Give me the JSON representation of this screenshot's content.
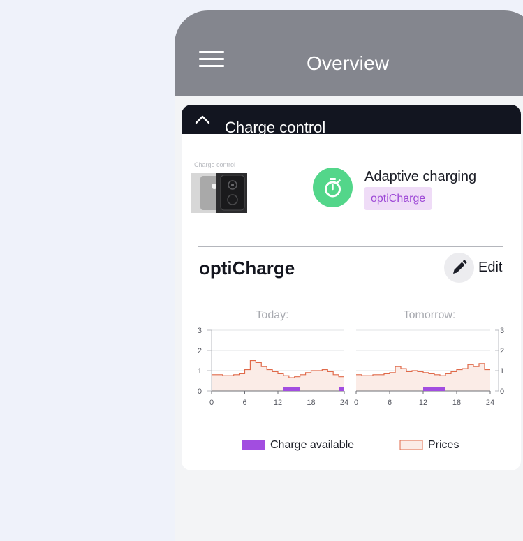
{
  "appbar": {
    "title": "Overview",
    "menu_icon": "hamburger-menu-icon"
  },
  "section": {
    "title": "Charge control",
    "icon": "chevron-up-icon"
  },
  "device": {
    "caption": "Charge control"
  },
  "mode": {
    "title": "Adaptive charging",
    "badge": "optiCharge",
    "icon": "timer-icon"
  },
  "opticharge": {
    "heading": "optiCharge",
    "edit_label": "Edit",
    "edit_icon": "pencil-icon"
  },
  "colors": {
    "appbar": "#84868e",
    "section_header": "#121520",
    "mode_icon_bg": "#53d68a",
    "badge_bg": "#efdcf7",
    "badge_text": "#9d48d6",
    "charge_available": "#a24de0",
    "price_line": "#e06a4a",
    "price_fill": "#fbece7"
  },
  "chart_data": [
    {
      "type": "area",
      "title": "Today:",
      "ylim": [
        0,
        3
      ],
      "y_ticks": [
        "0",
        "1",
        "2",
        "3"
      ],
      "xlim": [
        0,
        24
      ],
      "x_ticks": [
        "0",
        "6",
        "12",
        "18",
        "24"
      ],
      "series": [
        {
          "name": "Prices",
          "x": [
            0,
            1,
            2,
            3,
            4,
            5,
            6,
            7,
            8,
            9,
            10,
            11,
            12,
            13,
            14,
            15,
            16,
            17,
            18,
            19,
            20,
            21,
            22,
            23,
            24
          ],
          "values": [
            0.8,
            0.8,
            0.75,
            0.75,
            0.8,
            0.85,
            1.05,
            1.5,
            1.4,
            1.2,
            1.05,
            0.95,
            0.85,
            0.75,
            0.65,
            0.7,
            0.8,
            0.9,
            1.0,
            1.0,
            1.05,
            0.95,
            0.8,
            0.7,
            0.7
          ]
        },
        {
          "name": "Charge available",
          "intervals": [
            [
              13,
              16
            ],
            [
              23,
              24
            ]
          ]
        }
      ],
      "grid": true,
      "y_axis": "left"
    },
    {
      "type": "area",
      "title": "Tomorrow:",
      "ylim": [
        0,
        3
      ],
      "y_ticks": [
        "0",
        "1",
        "2",
        "3"
      ],
      "xlim": [
        0,
        24
      ],
      "x_ticks": [
        "0",
        "6",
        "12",
        "18",
        "24"
      ],
      "series": [
        {
          "name": "Prices",
          "x": [
            0,
            1,
            2,
            3,
            4,
            5,
            6,
            7,
            8,
            9,
            10,
            11,
            12,
            13,
            14,
            15,
            16,
            17,
            18,
            19,
            20,
            21,
            22,
            23,
            24
          ],
          "values": [
            0.8,
            0.75,
            0.75,
            0.8,
            0.8,
            0.85,
            0.9,
            1.2,
            1.1,
            0.95,
            1.0,
            0.95,
            0.9,
            0.85,
            0.8,
            0.75,
            0.85,
            0.95,
            1.05,
            1.1,
            1.3,
            1.2,
            1.35,
            1.05,
            0.9
          ]
        },
        {
          "name": "Charge available",
          "intervals": [
            [
              12,
              16
            ]
          ]
        }
      ],
      "grid": true,
      "y_axis": "right"
    }
  ],
  "legend": {
    "charge": "Charge available",
    "prices": "Prices",
    "placement": "bottom"
  }
}
